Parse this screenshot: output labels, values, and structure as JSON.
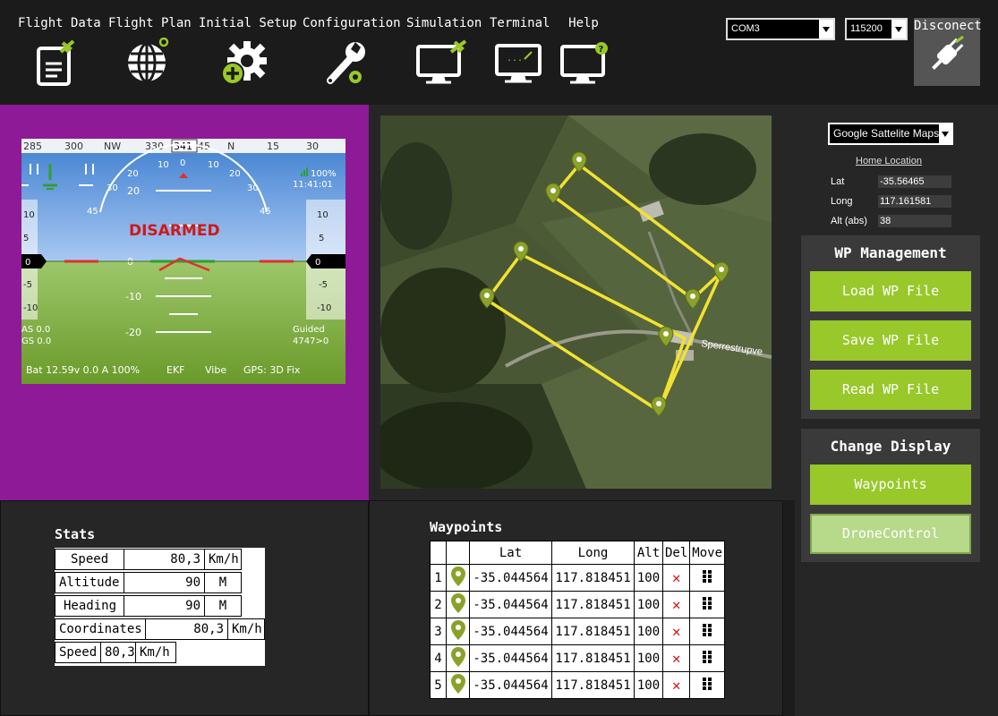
{
  "toolbar": {
    "tabs": [
      {
        "label": "Flight Data",
        "icon": "document-plane-icon"
      },
      {
        "label": "Flight Plan",
        "icon": "globe-pin-icon"
      },
      {
        "label": "Initial Setup",
        "icon": "gear-plus-icon"
      },
      {
        "label": "Configuration",
        "icon": "wrench-gear-icon"
      },
      {
        "label": "Simulation",
        "icon": "monitor-plane-icon"
      },
      {
        "label": "Terminal",
        "icon": "monitor-terminal-icon"
      },
      {
        "label": "Help",
        "icon": "monitor-help-icon"
      }
    ],
    "port": "COM3",
    "baud": "115200",
    "disconnect_label": "Disconect"
  },
  "hud": {
    "heading_ticks": [
      "285",
      "300",
      "NW",
      "330",
      "345",
      "N",
      "15",
      "30"
    ],
    "heading_value": "341",
    "roll_ticks": [
      "45",
      "30",
      "20",
      "10",
      "0",
      "10",
      "20",
      "30",
      "45"
    ],
    "pitch_ticks": [
      "20",
      "0",
      "-10",
      "-20"
    ],
    "left_scale": [
      "10",
      "5",
      "-5",
      "-10"
    ],
    "right_scale": [
      "10",
      "5",
      "-5",
      "-10"
    ],
    "left_box_value": "0",
    "right_box_value": "0",
    "battery_pct": "100%",
    "time": "11:41:01",
    "status": "DISARMED",
    "airspeed": "AS 0.0",
    "groundspeed": "GS 0.0",
    "mode": "Guided",
    "dist": "4747>0",
    "battery_line": "Bat 12.59v 0.0 A 100%",
    "ekf": "EKF",
    "vibe": "Vibe",
    "gps": "GPS: 3D Fix"
  },
  "map": {
    "road_label": "Sperrestrupve"
  },
  "side": {
    "map_source": "Google Sattelite Maps",
    "home_title": "Home Location",
    "home": [
      {
        "label": "Lat",
        "value": "-35.56465"
      },
      {
        "label": "Long",
        "value": "117.161581"
      },
      {
        "label": "Alt (abs)",
        "value": "38"
      }
    ],
    "wp_mgmt_title": "WP Management",
    "wp_buttons": [
      "Load WP File",
      "Save WP File",
      "Read WP File"
    ],
    "display_title": "Change Display",
    "display_buttons": [
      "Waypoints",
      "DroneControl"
    ]
  },
  "stats": {
    "title": "Stats",
    "rows": [
      {
        "label": "Speed",
        "value": "80,3",
        "unit": "Km/h"
      },
      {
        "label": "Altitude",
        "value": "90",
        "unit": "M"
      },
      {
        "label": "Heading",
        "value": "90",
        "unit": "M"
      },
      {
        "label": "Coordinates",
        "value": "80,3",
        "unit": "Km/h"
      },
      {
        "label": "Speed",
        "value": "80,3",
        "unit": "Km/h"
      }
    ]
  },
  "waypoints": {
    "title": "Waypoints",
    "headers": [
      "",
      "",
      "Lat",
      "Long",
      "Alt",
      "Del",
      "Move"
    ],
    "rows": [
      {
        "n": "1",
        "lat": "-35.044564",
        "long": "117.818451",
        "alt": "100"
      },
      {
        "n": "2",
        "lat": "-35.044564",
        "long": "117.818451",
        "alt": "100"
      },
      {
        "n": "3",
        "lat": "-35.044564",
        "long": "117.818451",
        "alt": "100"
      },
      {
        "n": "4",
        "lat": "-35.044564",
        "long": "117.818451",
        "alt": "100"
      },
      {
        "n": "5",
        "lat": "-35.044564",
        "long": "117.818451",
        "alt": "100"
      }
    ]
  },
  "colors": {
    "accent": "#98c82a",
    "hud_panel": "#8e1a98",
    "route": "#f2e230",
    "pin": "#8aa22a"
  }
}
